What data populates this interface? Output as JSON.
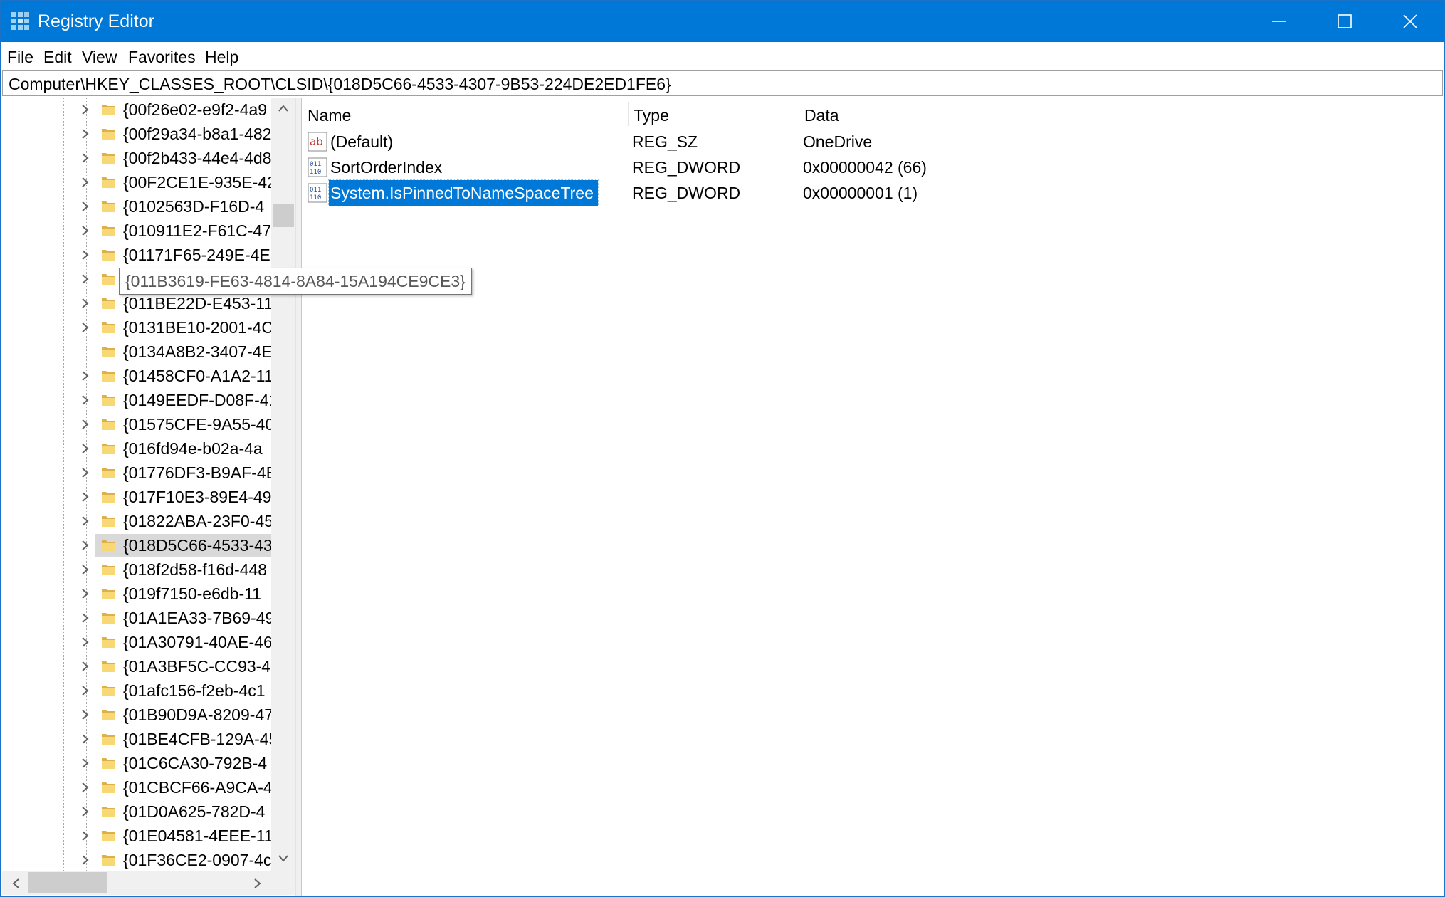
{
  "window": {
    "title": "Registry Editor"
  },
  "menu": [
    "File",
    "Edit",
    "View",
    "Favorites",
    "Help"
  ],
  "address": "Computer\\HKEY_CLASSES_ROOT\\CLSID\\{018D5C66-4533-4307-9B53-224DE2ED1FE6}",
  "tree": {
    "items": [
      {
        "label": "{00f26e02-e9f2-4a9",
        "expandable": true
      },
      {
        "label": "{00f29a34-b8a1-482",
        "expandable": true
      },
      {
        "label": "{00f2b433-44e4-4d8",
        "expandable": true
      },
      {
        "label": "{00F2CE1E-935E-42",
        "expandable": true
      },
      {
        "label": "{0102563D-F16D-4",
        "expandable": true
      },
      {
        "label": "{010911E2-F61C-47",
        "expandable": true
      },
      {
        "label": "{01171F65-249E-4E",
        "expandable": true
      },
      {
        "label": "{011B3619-FE63-48",
        "expandable": true
      },
      {
        "label": "{011BE22D-E453-11",
        "expandable": true
      },
      {
        "label": "{0131BE10-2001-4C",
        "expandable": true
      },
      {
        "label": "{0134A8B2-3407-4E",
        "expandable": false
      },
      {
        "label": "{01458CF0-A1A2-11",
        "expandable": true
      },
      {
        "label": "{0149EEDF-D08F-41",
        "expandable": true
      },
      {
        "label": "{01575CFE-9A55-40",
        "expandable": true
      },
      {
        "label": "{016fd94e-b02a-4a",
        "expandable": true
      },
      {
        "label": "{01776DF3-B9AF-4E",
        "expandable": true
      },
      {
        "label": "{017F10E3-89E4-49",
        "expandable": true
      },
      {
        "label": "{01822ABA-23F0-45",
        "expandable": true
      },
      {
        "label": "{018D5C66-4533-43",
        "expandable": true,
        "selected": true
      },
      {
        "label": "{018f2d58-f16d-448",
        "expandable": true
      },
      {
        "label": "{019f7150-e6db-11",
        "expandable": true
      },
      {
        "label": "{01A1EA33-7B69-49",
        "expandable": true
      },
      {
        "label": "{01A30791-40AE-46",
        "expandable": true
      },
      {
        "label": "{01A3BF5C-CC93-4",
        "expandable": true
      },
      {
        "label": "{01afc156-f2eb-4c1",
        "expandable": true
      },
      {
        "label": "{01B90D9A-8209-47",
        "expandable": true
      },
      {
        "label": "{01BE4CFB-129A-45",
        "expandable": true
      },
      {
        "label": "{01C6CA30-792B-4",
        "expandable": true
      },
      {
        "label": "{01CBCF66-A9CA-4",
        "expandable": true
      },
      {
        "label": "{01D0A625-782D-4",
        "expandable": true
      },
      {
        "label": "{01E04581-4EEE-11",
        "expandable": true
      },
      {
        "label": "{01F36CE2-0907-4c",
        "expandable": true
      }
    ]
  },
  "tooltip": "{011B3619-FE63-4814-8A84-15A194CE9CE3}",
  "list": {
    "columns": [
      "Name",
      "Type",
      "Data"
    ],
    "rows": [
      {
        "icon": "string-value-icon",
        "name": "(Default)",
        "type": "REG_SZ",
        "data": "OneDrive"
      },
      {
        "icon": "binary-value-icon",
        "name": "SortOrderIndex",
        "type": "REG_DWORD",
        "data": "0x00000042 (66)"
      },
      {
        "icon": "binary-value-icon",
        "name": "System.IsPinnedToNameSpaceTree",
        "type": "REG_DWORD",
        "data": "0x00000001 (1)",
        "selected": true
      }
    ]
  },
  "colors": {
    "titlebar": "#0078d7",
    "selection": "#0078d7",
    "tree_selection": "#d9d9d9",
    "folder": "#f8d775"
  }
}
